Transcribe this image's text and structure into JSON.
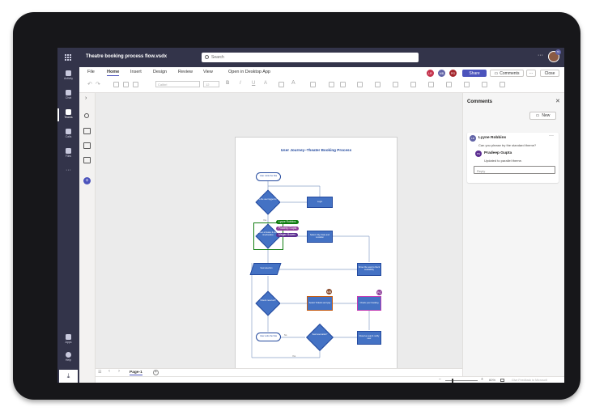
{
  "window": {
    "title": "Theatre booking process flow.vsdx",
    "more": "···",
    "user_badge": "TA"
  },
  "search": {
    "placeholder": "Search"
  },
  "rail": [
    {
      "label": "Activity"
    },
    {
      "label": "Chat"
    },
    {
      "label": "Teams",
      "active": true
    },
    {
      "label": "Calls"
    },
    {
      "label": "Files"
    },
    {
      "label": "···"
    }
  ],
  "rail_bottom": [
    {
      "label": "Apps"
    },
    {
      "label": "Help"
    }
  ],
  "ribbon": {
    "tabs": [
      "File",
      "Home",
      "Insert",
      "Design",
      "Review",
      "View"
    ],
    "active_tab": "Home",
    "open_desktop": "Open in Desktop App",
    "font_name": "Calibri",
    "font_size": "12",
    "bold": "B",
    "italic": "I",
    "underline": "U",
    "font_color": "A",
    "bigger_font": "A",
    "share": "Share",
    "comments": "Comments",
    "more": "···",
    "close": "Close",
    "presence": [
      {
        "initials": "LR",
        "color": "#c4314b"
      },
      {
        "initials": "MB",
        "color": "#6264a7"
      },
      {
        "initials": "PG",
        "color": "#a4262c"
      }
    ]
  },
  "diagram": {
    "title": "User Journey–Theater Booking Process",
    "shapes": {
      "start": "User visits the Site",
      "decision1": "Is the user logged in?",
      "login": "Login",
      "yes1": "Yes",
      "select_theater": "Select a theater & show time/location",
      "select_city": "Select City, Date and Location",
      "show_seats": "Show the seat & check availability",
      "seat_selection": "Seat selection",
      "decision2": "Ticket/s reserved?",
      "select_tickets": "Select Ticket/s and pay",
      "booking_confirm": "Check your booking",
      "user_exits": "User exits the Site",
      "decision3": "Seat reservation?",
      "extra": "Reserve seat & notify user",
      "no": "No",
      "yes2": "Yes"
    },
    "cursor_tags": [
      {
        "name": "Lyyne Robbins",
        "color": "#107c10"
      },
      {
        "name": "Pradeep Gupta",
        "color": "#8e3d99"
      },
      {
        "name": "Megan Bowen",
        "color": "#5c2e91"
      }
    ],
    "bubble_labels": [
      "MB",
      "PG"
    ]
  },
  "pages": {
    "current": "Page-1",
    "add": "+",
    "nav": [
      "‹",
      "›"
    ]
  },
  "status": {
    "zoom": "60%",
    "feedback": "Give Feedback to Microsoft"
  },
  "comments": {
    "title": "Comments",
    "new_label": "New",
    "thread": {
      "author": "Lyyne Robbins",
      "author_initials": "LR",
      "text": "Can you please try the standard theme?",
      "reply_author": "Pradeep Gupta",
      "reply_initials": "PG",
      "reply_text": "Updated to parallel theme.",
      "reply_placeholder": "Reply",
      "more": "···"
    }
  },
  "colors": {
    "teams_dark": "#33344a",
    "accent": "#6264a7",
    "shape_blue": "#4472c4",
    "selection_green": "#107c10"
  }
}
